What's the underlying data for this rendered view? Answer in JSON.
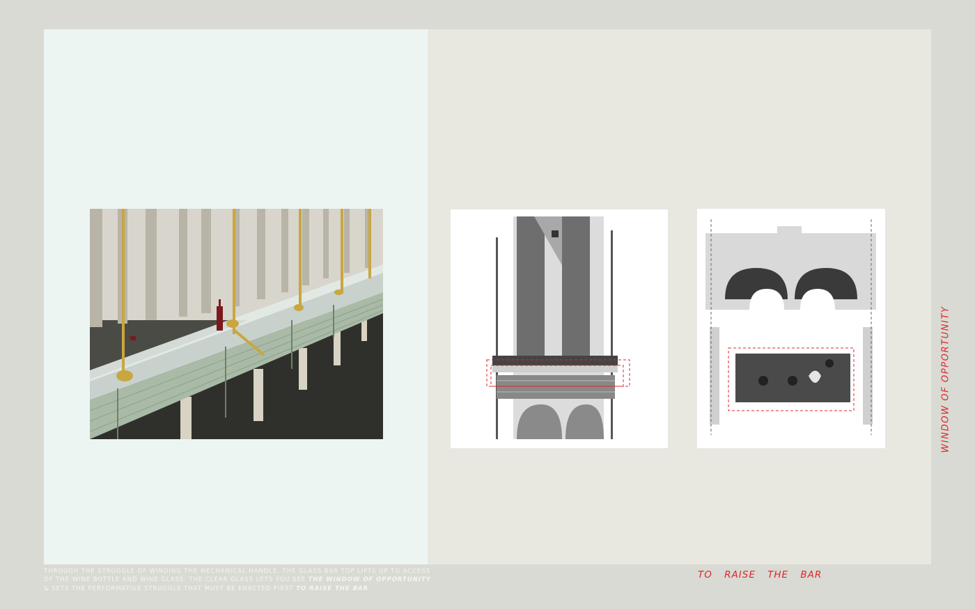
{
  "title": "WINDOW OF OPPORTUNITY",
  "tagline": "TO RAISE THE BAR",
  "caption": {
    "part1": "THROUGH THE STRUGGLE OF WINDING THE MECHANICAL HANDLE, THE GLASS BAR TOP LIFTS UP TO ACCESS OF THE WINE BOTTLE AND WINE GLASS. THE CLEAR GLASS LETS YOU SEE ",
    "em1": "THE WINDOW OF OPPORTUNITY",
    "part2": " & SETS THE PERFORMATIVE STRUGGLE THAT MUST BE ENACTED FIRST ",
    "em2": "TO RAISE THE BAR"
  },
  "colors": {
    "background": "#d9dad3",
    "left_panel": "#edf5f2",
    "right_panel": "#e8e8e1",
    "accent_red": "#e0262a",
    "brass": "#c9a640"
  },
  "images": {
    "render": "bar-render-perspective",
    "section_a": "bar-section-front",
    "section_b": "bar-section-detail"
  }
}
